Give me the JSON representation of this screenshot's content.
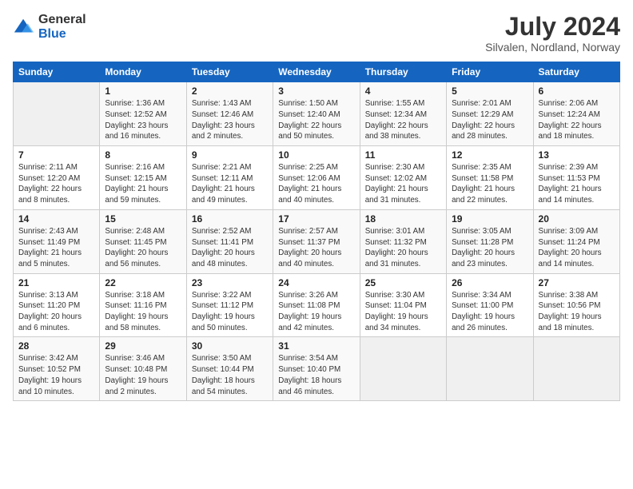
{
  "header": {
    "logo_general": "General",
    "logo_blue": "Blue",
    "title": "July 2024",
    "subtitle": "Silvalen, Nordland, Norway"
  },
  "columns": [
    "Sunday",
    "Monday",
    "Tuesday",
    "Wednesday",
    "Thursday",
    "Friday",
    "Saturday"
  ],
  "weeks": [
    [
      {
        "day": "",
        "info": ""
      },
      {
        "day": "1",
        "info": "Sunrise: 1:36 AM\nSunset: 12:52 AM\nDaylight: 23 hours\nand 16 minutes."
      },
      {
        "day": "2",
        "info": "Sunrise: 1:43 AM\nSunset: 12:46 AM\nDaylight: 23 hours\nand 2 minutes."
      },
      {
        "day": "3",
        "info": "Sunrise: 1:50 AM\nSunset: 12:40 AM\nDaylight: 22 hours\nand 50 minutes."
      },
      {
        "day": "4",
        "info": "Sunrise: 1:55 AM\nSunset: 12:34 AM\nDaylight: 22 hours\nand 38 minutes."
      },
      {
        "day": "5",
        "info": "Sunrise: 2:01 AM\nSunset: 12:29 AM\nDaylight: 22 hours\nand 28 minutes."
      },
      {
        "day": "6",
        "info": "Sunrise: 2:06 AM\nSunset: 12:24 AM\nDaylight: 22 hours\nand 18 minutes."
      }
    ],
    [
      {
        "day": "7",
        "info": "Sunrise: 2:11 AM\nSunset: 12:20 AM\nDaylight: 22 hours\nand 8 minutes."
      },
      {
        "day": "8",
        "info": "Sunrise: 2:16 AM\nSunset: 12:15 AM\nDaylight: 21 hours\nand 59 minutes."
      },
      {
        "day": "9",
        "info": "Sunrise: 2:21 AM\nSunset: 12:11 AM\nDaylight: 21 hours\nand 49 minutes."
      },
      {
        "day": "10",
        "info": "Sunrise: 2:25 AM\nSunset: 12:06 AM\nDaylight: 21 hours\nand 40 minutes."
      },
      {
        "day": "11",
        "info": "Sunrise: 2:30 AM\nSunset: 12:02 AM\nDaylight: 21 hours\nand 31 minutes."
      },
      {
        "day": "12",
        "info": "Sunrise: 2:35 AM\nSunset: 11:58 PM\nDaylight: 21 hours\nand 22 minutes."
      },
      {
        "day": "13",
        "info": "Sunrise: 2:39 AM\nSunset: 11:53 PM\nDaylight: 21 hours\nand 14 minutes."
      }
    ],
    [
      {
        "day": "14",
        "info": "Sunrise: 2:43 AM\nSunset: 11:49 PM\nDaylight: 21 hours\nand 5 minutes."
      },
      {
        "day": "15",
        "info": "Sunrise: 2:48 AM\nSunset: 11:45 PM\nDaylight: 20 hours\nand 56 minutes."
      },
      {
        "day": "16",
        "info": "Sunrise: 2:52 AM\nSunset: 11:41 PM\nDaylight: 20 hours\nand 48 minutes."
      },
      {
        "day": "17",
        "info": "Sunrise: 2:57 AM\nSunset: 11:37 PM\nDaylight: 20 hours\nand 40 minutes."
      },
      {
        "day": "18",
        "info": "Sunrise: 3:01 AM\nSunset: 11:32 PM\nDaylight: 20 hours\nand 31 minutes."
      },
      {
        "day": "19",
        "info": "Sunrise: 3:05 AM\nSunset: 11:28 PM\nDaylight: 20 hours\nand 23 minutes."
      },
      {
        "day": "20",
        "info": "Sunrise: 3:09 AM\nSunset: 11:24 PM\nDaylight: 20 hours\nand 14 minutes."
      }
    ],
    [
      {
        "day": "21",
        "info": "Sunrise: 3:13 AM\nSunset: 11:20 PM\nDaylight: 20 hours\nand 6 minutes."
      },
      {
        "day": "22",
        "info": "Sunrise: 3:18 AM\nSunset: 11:16 PM\nDaylight: 19 hours\nand 58 minutes."
      },
      {
        "day": "23",
        "info": "Sunrise: 3:22 AM\nSunset: 11:12 PM\nDaylight: 19 hours\nand 50 minutes."
      },
      {
        "day": "24",
        "info": "Sunrise: 3:26 AM\nSunset: 11:08 PM\nDaylight: 19 hours\nand 42 minutes."
      },
      {
        "day": "25",
        "info": "Sunrise: 3:30 AM\nSunset: 11:04 PM\nDaylight: 19 hours\nand 34 minutes."
      },
      {
        "day": "26",
        "info": "Sunrise: 3:34 AM\nSunset: 11:00 PM\nDaylight: 19 hours\nand 26 minutes."
      },
      {
        "day": "27",
        "info": "Sunrise: 3:38 AM\nSunset: 10:56 PM\nDaylight: 19 hours\nand 18 minutes."
      }
    ],
    [
      {
        "day": "28",
        "info": "Sunrise: 3:42 AM\nSunset: 10:52 PM\nDaylight: 19 hours\nand 10 minutes."
      },
      {
        "day": "29",
        "info": "Sunrise: 3:46 AM\nSunset: 10:48 PM\nDaylight: 19 hours\nand 2 minutes."
      },
      {
        "day": "30",
        "info": "Sunrise: 3:50 AM\nSunset: 10:44 PM\nDaylight: 18 hours\nand 54 minutes."
      },
      {
        "day": "31",
        "info": "Sunrise: 3:54 AM\nSunset: 10:40 PM\nDaylight: 18 hours\nand 46 minutes."
      },
      {
        "day": "",
        "info": ""
      },
      {
        "day": "",
        "info": ""
      },
      {
        "day": "",
        "info": ""
      }
    ]
  ]
}
